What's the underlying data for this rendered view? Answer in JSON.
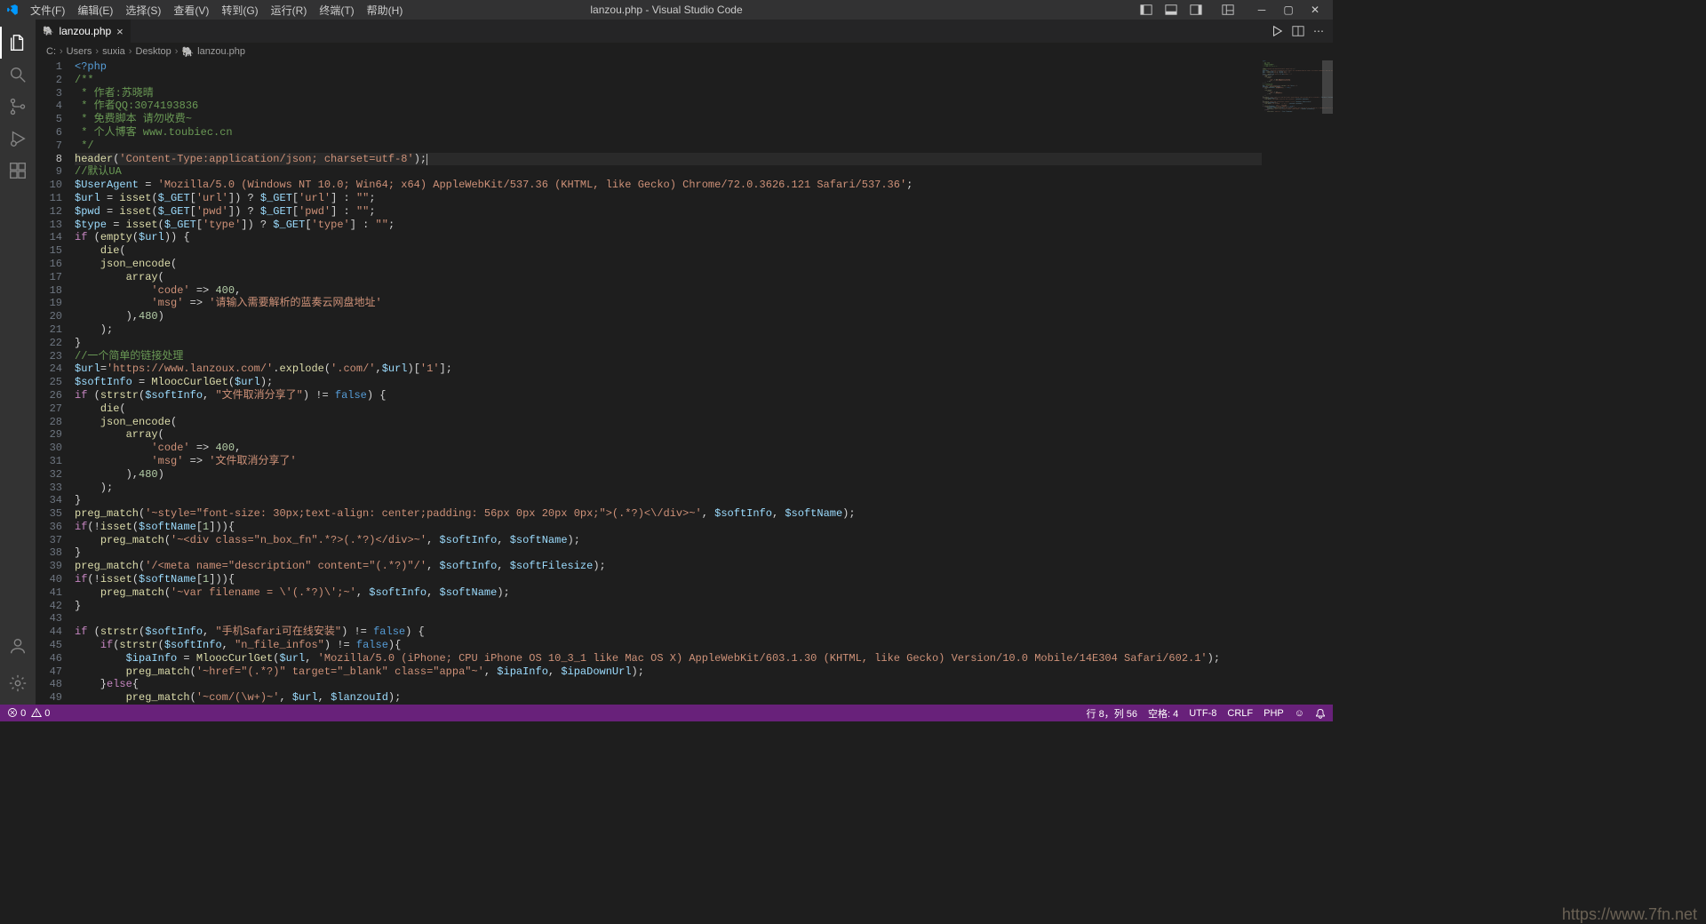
{
  "title": "lanzou.php - Visual Studio Code",
  "menu": [
    "文件(F)",
    "编辑(E)",
    "选择(S)",
    "查看(V)",
    "转到(G)",
    "运行(R)",
    "终端(T)",
    "帮助(H)"
  ],
  "tab": {
    "label": "lanzou.php"
  },
  "breadcrumb": [
    "C:",
    "Users",
    "suxia",
    "Desktop",
    "lanzou.php"
  ],
  "status": {
    "errors": "0",
    "warnings": "0",
    "lncol": "行 8，列 56",
    "spaces": "空格: 4",
    "encoding": "UTF-8",
    "eol": "CRLF",
    "lang": "PHP",
    "feedback": "☺"
  },
  "watermark": "https://www.7fn.net",
  "lines": [
    {
      "n": 1,
      "seg": [
        {
          "t": "<?php",
          "c": "c-kw2"
        }
      ]
    },
    {
      "n": 2,
      "seg": [
        {
          "t": "/**",
          "c": "c-cmt"
        }
      ]
    },
    {
      "n": 3,
      "seg": [
        {
          "t": " * 作者:苏晓晴",
          "c": "c-cmt"
        }
      ]
    },
    {
      "n": 4,
      "seg": [
        {
          "t": " * 作者QQ:3074193836",
          "c": "c-cmt"
        }
      ]
    },
    {
      "n": 5,
      "seg": [
        {
          "t": " * 免费脚本 请勿收费~",
          "c": "c-cmt"
        }
      ]
    },
    {
      "n": 6,
      "seg": [
        {
          "t": " * 个人博客 www.toubiec.cn",
          "c": "c-cmt"
        }
      ]
    },
    {
      "n": 7,
      "seg": [
        {
          "t": " */",
          "c": "c-cmt"
        }
      ]
    },
    {
      "n": 8,
      "current": true,
      "seg": [
        {
          "t": "header",
          "c": "c-fn"
        },
        {
          "t": "(",
          "c": "c-op"
        },
        {
          "t": "'Content-Type:application/json; charset=utf-8'",
          "c": "c-str"
        },
        {
          "t": ");",
          "c": "c-op"
        }
      ]
    },
    {
      "n": 9,
      "seg": [
        {
          "t": "//默认UA",
          "c": "c-cmt"
        }
      ]
    },
    {
      "n": 10,
      "seg": [
        {
          "t": "$UserAgent",
          "c": "c-var"
        },
        {
          "t": " = ",
          "c": "c-op"
        },
        {
          "t": "'Mozilla/5.0 (Windows NT 10.0; Win64; x64) AppleWebKit/537.36 (KHTML, like Gecko) Chrome/72.0.3626.121 Safari/537.36'",
          "c": "c-str"
        },
        {
          "t": ";",
          "c": "c-op"
        }
      ]
    },
    {
      "n": 11,
      "seg": [
        {
          "t": "$url",
          "c": "c-var"
        },
        {
          "t": " = ",
          "c": "c-op"
        },
        {
          "t": "isset",
          "c": "c-fn"
        },
        {
          "t": "(",
          "c": "c-op"
        },
        {
          "t": "$_GET",
          "c": "c-var"
        },
        {
          "t": "[",
          "c": "c-op"
        },
        {
          "t": "'url'",
          "c": "c-str"
        },
        {
          "t": "]) ? ",
          "c": "c-op"
        },
        {
          "t": "$_GET",
          "c": "c-var"
        },
        {
          "t": "[",
          "c": "c-op"
        },
        {
          "t": "'url'",
          "c": "c-str"
        },
        {
          "t": "] : ",
          "c": "c-op"
        },
        {
          "t": "\"\"",
          "c": "c-str"
        },
        {
          "t": ";",
          "c": "c-op"
        }
      ]
    },
    {
      "n": 12,
      "seg": [
        {
          "t": "$pwd",
          "c": "c-var"
        },
        {
          "t": " = ",
          "c": "c-op"
        },
        {
          "t": "isset",
          "c": "c-fn"
        },
        {
          "t": "(",
          "c": "c-op"
        },
        {
          "t": "$_GET",
          "c": "c-var"
        },
        {
          "t": "[",
          "c": "c-op"
        },
        {
          "t": "'pwd'",
          "c": "c-str"
        },
        {
          "t": "]) ? ",
          "c": "c-op"
        },
        {
          "t": "$_GET",
          "c": "c-var"
        },
        {
          "t": "[",
          "c": "c-op"
        },
        {
          "t": "'pwd'",
          "c": "c-str"
        },
        {
          "t": "] : ",
          "c": "c-op"
        },
        {
          "t": "\"\"",
          "c": "c-str"
        },
        {
          "t": ";",
          "c": "c-op"
        }
      ]
    },
    {
      "n": 13,
      "seg": [
        {
          "t": "$type",
          "c": "c-var"
        },
        {
          "t": " = ",
          "c": "c-op"
        },
        {
          "t": "isset",
          "c": "c-fn"
        },
        {
          "t": "(",
          "c": "c-op"
        },
        {
          "t": "$_GET",
          "c": "c-var"
        },
        {
          "t": "[",
          "c": "c-op"
        },
        {
          "t": "'type'",
          "c": "c-str"
        },
        {
          "t": "]) ? ",
          "c": "c-op"
        },
        {
          "t": "$_GET",
          "c": "c-var"
        },
        {
          "t": "[",
          "c": "c-op"
        },
        {
          "t": "'type'",
          "c": "c-str"
        },
        {
          "t": "] : ",
          "c": "c-op"
        },
        {
          "t": "\"\"",
          "c": "c-str"
        },
        {
          "t": ";",
          "c": "c-op"
        }
      ]
    },
    {
      "n": 14,
      "seg": [
        {
          "t": "if",
          "c": "c-kw"
        },
        {
          "t": " (",
          "c": "c-op"
        },
        {
          "t": "empty",
          "c": "c-fn"
        },
        {
          "t": "(",
          "c": "c-op"
        },
        {
          "t": "$url",
          "c": "c-var"
        },
        {
          "t": ")) {",
          "c": "c-op"
        }
      ]
    },
    {
      "n": 15,
      "seg": [
        {
          "t": "    ",
          "c": "c-sp"
        },
        {
          "t": "die",
          "c": "c-fn"
        },
        {
          "t": "(",
          "c": "c-op"
        }
      ]
    },
    {
      "n": 16,
      "seg": [
        {
          "t": "    ",
          "c": "c-sp"
        },
        {
          "t": "json_encode",
          "c": "c-fn"
        },
        {
          "t": "(",
          "c": "c-op"
        }
      ]
    },
    {
      "n": 17,
      "seg": [
        {
          "t": "        ",
          "c": "c-sp"
        },
        {
          "t": "array",
          "c": "c-fn"
        },
        {
          "t": "(",
          "c": "c-op"
        }
      ]
    },
    {
      "n": 18,
      "seg": [
        {
          "t": "            ",
          "c": "c-sp"
        },
        {
          "t": "'code'",
          "c": "c-str"
        },
        {
          "t": " => ",
          "c": "c-op"
        },
        {
          "t": "400",
          "c": "c-num"
        },
        {
          "t": ",",
          "c": "c-op"
        }
      ]
    },
    {
      "n": 19,
      "seg": [
        {
          "t": "            ",
          "c": "c-sp"
        },
        {
          "t": "'msg'",
          "c": "c-str"
        },
        {
          "t": " => ",
          "c": "c-op"
        },
        {
          "t": "'请输入需要解析的蓝奏云网盘地址'",
          "c": "c-str"
        }
      ]
    },
    {
      "n": 20,
      "seg": [
        {
          "t": "        ),",
          "c": "c-op"
        },
        {
          "t": "480",
          "c": "c-num"
        },
        {
          "t": ")",
          "c": "c-op"
        }
      ]
    },
    {
      "n": 21,
      "seg": [
        {
          "t": "    );",
          "c": "c-op"
        }
      ]
    },
    {
      "n": 22,
      "seg": [
        {
          "t": "}",
          "c": "c-op"
        }
      ]
    },
    {
      "n": 23,
      "seg": [
        {
          "t": "//一个简单的链接处理",
          "c": "c-cmt"
        }
      ]
    },
    {
      "n": 24,
      "seg": [
        {
          "t": "$url",
          "c": "c-var"
        },
        {
          "t": "=",
          "c": "c-op"
        },
        {
          "t": "'https://www.lanzoux.com/'",
          "c": "c-str"
        },
        {
          "t": ".",
          "c": "c-op"
        },
        {
          "t": "explode",
          "c": "c-fn"
        },
        {
          "t": "(",
          "c": "c-op"
        },
        {
          "t": "'.com/'",
          "c": "c-str"
        },
        {
          "t": ",",
          "c": "c-op"
        },
        {
          "t": "$url",
          "c": "c-var"
        },
        {
          "t": ")[",
          "c": "c-op"
        },
        {
          "t": "'1'",
          "c": "c-str"
        },
        {
          "t": "];",
          "c": "c-op"
        }
      ]
    },
    {
      "n": 25,
      "seg": [
        {
          "t": "$softInfo",
          "c": "c-var"
        },
        {
          "t": " = ",
          "c": "c-op"
        },
        {
          "t": "MloocCurlGet",
          "c": "c-fn"
        },
        {
          "t": "(",
          "c": "c-op"
        },
        {
          "t": "$url",
          "c": "c-var"
        },
        {
          "t": ");",
          "c": "c-op"
        }
      ]
    },
    {
      "n": 26,
      "seg": [
        {
          "t": "if",
          "c": "c-kw"
        },
        {
          "t": " (",
          "c": "c-op"
        },
        {
          "t": "strstr",
          "c": "c-fn"
        },
        {
          "t": "(",
          "c": "c-op"
        },
        {
          "t": "$softInfo",
          "c": "c-var"
        },
        {
          "t": ", ",
          "c": "c-op"
        },
        {
          "t": "\"文件取消分享了\"",
          "c": "c-str"
        },
        {
          "t": ") != ",
          "c": "c-op"
        },
        {
          "t": "false",
          "c": "c-kw2"
        },
        {
          "t": ") {",
          "c": "c-op"
        }
      ]
    },
    {
      "n": 27,
      "seg": [
        {
          "t": "    ",
          "c": "c-sp"
        },
        {
          "t": "die",
          "c": "c-fn"
        },
        {
          "t": "(",
          "c": "c-op"
        }
      ]
    },
    {
      "n": 28,
      "seg": [
        {
          "t": "    ",
          "c": "c-sp"
        },
        {
          "t": "json_encode",
          "c": "c-fn"
        },
        {
          "t": "(",
          "c": "c-op"
        }
      ]
    },
    {
      "n": 29,
      "seg": [
        {
          "t": "        ",
          "c": "c-sp"
        },
        {
          "t": "array",
          "c": "c-fn"
        },
        {
          "t": "(",
          "c": "c-op"
        }
      ]
    },
    {
      "n": 30,
      "seg": [
        {
          "t": "            ",
          "c": "c-sp"
        },
        {
          "t": "'code'",
          "c": "c-str"
        },
        {
          "t": " => ",
          "c": "c-op"
        },
        {
          "t": "400",
          "c": "c-num"
        },
        {
          "t": ",",
          "c": "c-op"
        }
      ]
    },
    {
      "n": 31,
      "seg": [
        {
          "t": "            ",
          "c": "c-sp"
        },
        {
          "t": "'msg'",
          "c": "c-str"
        },
        {
          "t": " => ",
          "c": "c-op"
        },
        {
          "t": "'文件取消分享了'",
          "c": "c-str"
        }
      ]
    },
    {
      "n": 32,
      "seg": [
        {
          "t": "        ),",
          "c": "c-op"
        },
        {
          "t": "480",
          "c": "c-num"
        },
        {
          "t": ")",
          "c": "c-op"
        }
      ]
    },
    {
      "n": 33,
      "seg": [
        {
          "t": "    );",
          "c": "c-op"
        }
      ]
    },
    {
      "n": 34,
      "seg": [
        {
          "t": "}",
          "c": "c-op"
        }
      ]
    },
    {
      "n": 35,
      "seg": [
        {
          "t": "preg_match",
          "c": "c-fn"
        },
        {
          "t": "(",
          "c": "c-op"
        },
        {
          "t": "'~style=\"font-size: 30px;text-align: center;padding: 56px 0px 20px 0px;\">(.*?)<\\/div>~'",
          "c": "c-str"
        },
        {
          "t": ", ",
          "c": "c-op"
        },
        {
          "t": "$softInfo",
          "c": "c-var"
        },
        {
          "t": ", ",
          "c": "c-op"
        },
        {
          "t": "$softName",
          "c": "c-var"
        },
        {
          "t": ");",
          "c": "c-op"
        }
      ]
    },
    {
      "n": 36,
      "seg": [
        {
          "t": "if",
          "c": "c-kw"
        },
        {
          "t": "(!",
          "c": "c-op"
        },
        {
          "t": "isset",
          "c": "c-fn"
        },
        {
          "t": "(",
          "c": "c-op"
        },
        {
          "t": "$softName",
          "c": "c-var"
        },
        {
          "t": "[",
          "c": "c-op"
        },
        {
          "t": "1",
          "c": "c-num"
        },
        {
          "t": "])){",
          "c": "c-op"
        }
      ]
    },
    {
      "n": 37,
      "seg": [
        {
          "t": "    ",
          "c": "c-sp"
        },
        {
          "t": "preg_match",
          "c": "c-fn"
        },
        {
          "t": "(",
          "c": "c-op"
        },
        {
          "t": "'~<div class=\"n_box_fn\".*?>(.*?)</div>~'",
          "c": "c-str"
        },
        {
          "t": ", ",
          "c": "c-op"
        },
        {
          "t": "$softInfo",
          "c": "c-var"
        },
        {
          "t": ", ",
          "c": "c-op"
        },
        {
          "t": "$softName",
          "c": "c-var"
        },
        {
          "t": ");",
          "c": "c-op"
        }
      ]
    },
    {
      "n": 38,
      "seg": [
        {
          "t": "}",
          "c": "c-op"
        }
      ]
    },
    {
      "n": 39,
      "seg": [
        {
          "t": "preg_match",
          "c": "c-fn"
        },
        {
          "t": "(",
          "c": "c-op"
        },
        {
          "t": "'/<meta name=\"description\" content=\"(.*?)\"/'",
          "c": "c-str"
        },
        {
          "t": ", ",
          "c": "c-op"
        },
        {
          "t": "$softInfo",
          "c": "c-var"
        },
        {
          "t": ", ",
          "c": "c-op"
        },
        {
          "t": "$softFilesize",
          "c": "c-var"
        },
        {
          "t": ");",
          "c": "c-op"
        }
      ]
    },
    {
      "n": 40,
      "seg": [
        {
          "t": "if",
          "c": "c-kw"
        },
        {
          "t": "(!",
          "c": "c-op"
        },
        {
          "t": "isset",
          "c": "c-fn"
        },
        {
          "t": "(",
          "c": "c-op"
        },
        {
          "t": "$softName",
          "c": "c-var"
        },
        {
          "t": "[",
          "c": "c-op"
        },
        {
          "t": "1",
          "c": "c-num"
        },
        {
          "t": "])){",
          "c": "c-op"
        }
      ]
    },
    {
      "n": 41,
      "seg": [
        {
          "t": "    ",
          "c": "c-sp"
        },
        {
          "t": "preg_match",
          "c": "c-fn"
        },
        {
          "t": "(",
          "c": "c-op"
        },
        {
          "t": "'~var filename = \\'(.*?)\\';~'",
          "c": "c-str"
        },
        {
          "t": ", ",
          "c": "c-op"
        },
        {
          "t": "$softInfo",
          "c": "c-var"
        },
        {
          "t": ", ",
          "c": "c-op"
        },
        {
          "t": "$softName",
          "c": "c-var"
        },
        {
          "t": ");",
          "c": "c-op"
        }
      ]
    },
    {
      "n": 42,
      "seg": [
        {
          "t": "}",
          "c": "c-op"
        }
      ]
    },
    {
      "n": 43,
      "seg": [
        {
          "t": "",
          "c": "c-op"
        }
      ]
    },
    {
      "n": 44,
      "seg": [
        {
          "t": "if",
          "c": "c-kw"
        },
        {
          "t": " (",
          "c": "c-op"
        },
        {
          "t": "strstr",
          "c": "c-fn"
        },
        {
          "t": "(",
          "c": "c-op"
        },
        {
          "t": "$softInfo",
          "c": "c-var"
        },
        {
          "t": ", ",
          "c": "c-op"
        },
        {
          "t": "\"手机Safari可在线安装\"",
          "c": "c-str"
        },
        {
          "t": ") != ",
          "c": "c-op"
        },
        {
          "t": "false",
          "c": "c-kw2"
        },
        {
          "t": ") {",
          "c": "c-op"
        }
      ]
    },
    {
      "n": 45,
      "seg": [
        {
          "t": "    ",
          "c": "c-sp"
        },
        {
          "t": "if",
          "c": "c-kw"
        },
        {
          "t": "(",
          "c": "c-op"
        },
        {
          "t": "strstr",
          "c": "c-fn"
        },
        {
          "t": "(",
          "c": "c-op"
        },
        {
          "t": "$softInfo",
          "c": "c-var"
        },
        {
          "t": ", ",
          "c": "c-op"
        },
        {
          "t": "\"n_file_infos\"",
          "c": "c-str"
        },
        {
          "t": ") != ",
          "c": "c-op"
        },
        {
          "t": "false",
          "c": "c-kw2"
        },
        {
          "t": "){",
          "c": "c-op"
        }
      ]
    },
    {
      "n": 46,
      "seg": [
        {
          "t": "        ",
          "c": "c-sp"
        },
        {
          "t": "$ipaInfo",
          "c": "c-var"
        },
        {
          "t": " = ",
          "c": "c-op"
        },
        {
          "t": "MloocCurlGet",
          "c": "c-fn"
        },
        {
          "t": "(",
          "c": "c-op"
        },
        {
          "t": "$url",
          "c": "c-var"
        },
        {
          "t": ", ",
          "c": "c-op"
        },
        {
          "t": "'Mozilla/5.0 (iPhone; CPU iPhone OS 10_3_1 like Mac OS X) AppleWebKit/603.1.30 (KHTML, like Gecko) Version/10.0 Mobile/14E304 Safari/602.1'",
          "c": "c-str"
        },
        {
          "t": ");",
          "c": "c-op"
        }
      ]
    },
    {
      "n": 47,
      "seg": [
        {
          "t": "        ",
          "c": "c-sp"
        },
        {
          "t": "preg_match",
          "c": "c-fn"
        },
        {
          "t": "(",
          "c": "c-op"
        },
        {
          "t": "'~href=\"(.*?)\" target=\"_blank\" class=\"appa\"~'",
          "c": "c-str"
        },
        {
          "t": ", ",
          "c": "c-op"
        },
        {
          "t": "$ipaInfo",
          "c": "c-var"
        },
        {
          "t": ", ",
          "c": "c-op"
        },
        {
          "t": "$ipaDownUrl",
          "c": "c-var"
        },
        {
          "t": ");",
          "c": "c-op"
        }
      ]
    },
    {
      "n": 48,
      "seg": [
        {
          "t": "    }",
          "c": "c-op"
        },
        {
          "t": "else",
          "c": "c-kw"
        },
        {
          "t": "{",
          "c": "c-op"
        }
      ]
    },
    {
      "n": 49,
      "seg": [
        {
          "t": "        ",
          "c": "c-sp"
        },
        {
          "t": "preg_match",
          "c": "c-fn"
        },
        {
          "t": "(",
          "c": "c-op"
        },
        {
          "t": "'~com/(\\w+)~'",
          "c": "c-str"
        },
        {
          "t": ", ",
          "c": "c-op"
        },
        {
          "t": "$url",
          "c": "c-var"
        },
        {
          "t": ", ",
          "c": "c-op"
        },
        {
          "t": "$lanzouId",
          "c": "c-var"
        },
        {
          "t": ");",
          "c": "c-op"
        }
      ]
    }
  ]
}
